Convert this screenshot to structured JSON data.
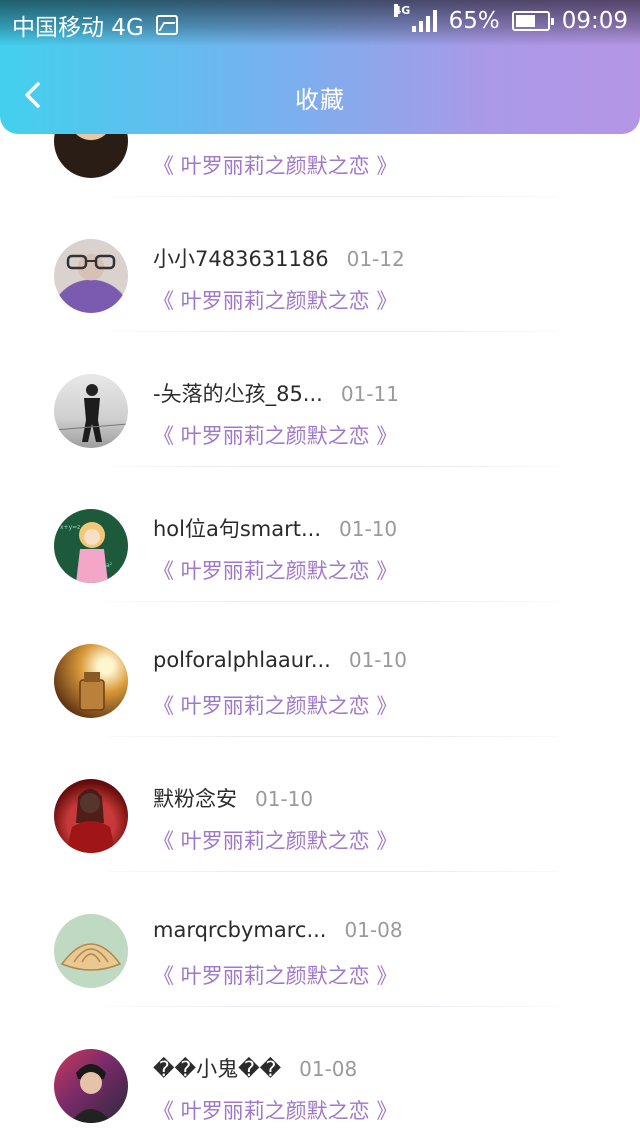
{
  "status_bar": {
    "carrier": "中国移动 4G",
    "network": "4G",
    "battery": "65%",
    "battery_level": 0.65,
    "time": "09:09"
  },
  "header": {
    "title": "收藏",
    "back_icon": "chevron-left-icon"
  },
  "colors": {
    "gradient_start": "#42d0ee",
    "gradient_end": "#b596e6",
    "link": "#a078c8"
  },
  "items": [
    {
      "username": "",
      "date": "",
      "title": "《 叶罗丽莉之颜默之恋 》",
      "avatar": "avatar-partial"
    },
    {
      "username": "小小7483631186",
      "date": "01-12",
      "title": "《 叶罗丽莉之颜默之恋 》",
      "avatar": "avatar-glasses-boy"
    },
    {
      "username": "-夨落的尐孩_85...",
      "date": "01-11",
      "title": "《 叶罗丽莉之颜默之恋 》",
      "avatar": "avatar-figure-photo"
    },
    {
      "username": "hol位a句smart...",
      "date": "01-10",
      "title": "《 叶罗丽莉之颜默之恋 》",
      "avatar": "avatar-anime-green"
    },
    {
      "username": "polforalphlaaur...",
      "date": "01-10",
      "title": "《 叶罗丽莉之颜默之恋 》",
      "avatar": "avatar-lighter"
    },
    {
      "username": "默粉念安",
      "date": "01-10",
      "title": "《 叶罗丽莉之颜默之恋 》",
      "avatar": "avatar-anime-red"
    },
    {
      "username": "marqrcbymarc...",
      "date": "01-08",
      "title": "《 叶罗丽莉之颜默之恋 》",
      "avatar": "avatar-seashell"
    },
    {
      "username": "��小鬼��",
      "date": "01-08",
      "title": "《 叶罗丽莉之颜默之恋 》",
      "avatar": "avatar-boy-portrait"
    }
  ]
}
